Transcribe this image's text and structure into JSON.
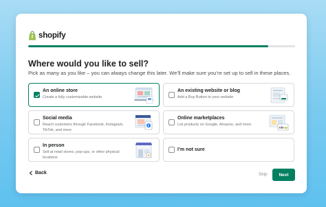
{
  "brand": {
    "name": "shopify",
    "accent": "#008060"
  },
  "progress": {
    "fraction": 0.9
  },
  "heading": "Where would you like to sell?",
  "subheading": "Pick as many as you like – you can always change this later. We’ll make sure you’re set up to sell in these places.",
  "options": [
    {
      "title": "An online store",
      "description": "Create a fully customizable website",
      "checked": true,
      "icon": "online-store-illustration"
    },
    {
      "title": "An existing website or blog",
      "description": "Add a Buy Button to your website",
      "checked": false,
      "icon": "website-illustration"
    },
    {
      "title": "Social media",
      "description": "Reach customers through Facebook, Instagram, TikTok, and more",
      "checked": false,
      "icon": "social-media-illustration"
    },
    {
      "title": "Online marketplaces",
      "description": "List products on Google, Amazon, and more",
      "checked": false,
      "icon": "marketplaces-illustration"
    },
    {
      "title": "In person",
      "description": "Sell at retail stores, pop-ups, or other physical locations",
      "checked": false,
      "icon": "in-person-illustration"
    },
    {
      "title": "I’m not sure",
      "description": "",
      "checked": false,
      "icon": ""
    }
  ],
  "footer": {
    "back_label": "Back",
    "skip_label": "Skip",
    "next_label": "Next"
  }
}
